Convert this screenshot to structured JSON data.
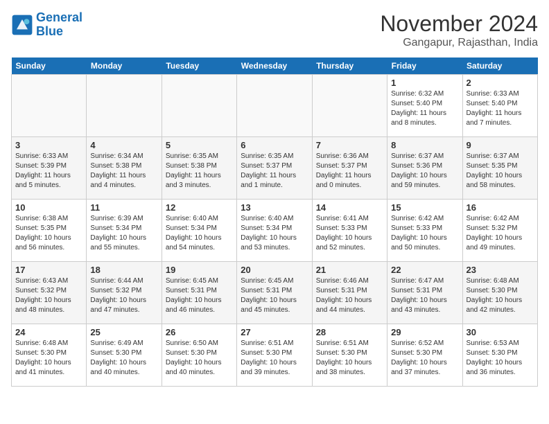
{
  "header": {
    "logo_line1": "General",
    "logo_line2": "Blue",
    "month": "November 2024",
    "location": "Gangapur, Rajasthan, India"
  },
  "weekdays": [
    "Sunday",
    "Monday",
    "Tuesday",
    "Wednesday",
    "Thursday",
    "Friday",
    "Saturday"
  ],
  "weeks": [
    [
      {
        "day": "",
        "info": ""
      },
      {
        "day": "",
        "info": ""
      },
      {
        "day": "",
        "info": ""
      },
      {
        "day": "",
        "info": ""
      },
      {
        "day": "",
        "info": ""
      },
      {
        "day": "1",
        "info": "Sunrise: 6:32 AM\nSunset: 5:40 PM\nDaylight: 11 hours and 8 minutes."
      },
      {
        "day": "2",
        "info": "Sunrise: 6:33 AM\nSunset: 5:40 PM\nDaylight: 11 hours and 7 minutes."
      }
    ],
    [
      {
        "day": "3",
        "info": "Sunrise: 6:33 AM\nSunset: 5:39 PM\nDaylight: 11 hours and 5 minutes."
      },
      {
        "day": "4",
        "info": "Sunrise: 6:34 AM\nSunset: 5:38 PM\nDaylight: 11 hours and 4 minutes."
      },
      {
        "day": "5",
        "info": "Sunrise: 6:35 AM\nSunset: 5:38 PM\nDaylight: 11 hours and 3 minutes."
      },
      {
        "day": "6",
        "info": "Sunrise: 6:35 AM\nSunset: 5:37 PM\nDaylight: 11 hours and 1 minute."
      },
      {
        "day": "7",
        "info": "Sunrise: 6:36 AM\nSunset: 5:37 PM\nDaylight: 11 hours and 0 minutes."
      },
      {
        "day": "8",
        "info": "Sunrise: 6:37 AM\nSunset: 5:36 PM\nDaylight: 10 hours and 59 minutes."
      },
      {
        "day": "9",
        "info": "Sunrise: 6:37 AM\nSunset: 5:35 PM\nDaylight: 10 hours and 58 minutes."
      }
    ],
    [
      {
        "day": "10",
        "info": "Sunrise: 6:38 AM\nSunset: 5:35 PM\nDaylight: 10 hours and 56 minutes."
      },
      {
        "day": "11",
        "info": "Sunrise: 6:39 AM\nSunset: 5:34 PM\nDaylight: 10 hours and 55 minutes."
      },
      {
        "day": "12",
        "info": "Sunrise: 6:40 AM\nSunset: 5:34 PM\nDaylight: 10 hours and 54 minutes."
      },
      {
        "day": "13",
        "info": "Sunrise: 6:40 AM\nSunset: 5:34 PM\nDaylight: 10 hours and 53 minutes."
      },
      {
        "day": "14",
        "info": "Sunrise: 6:41 AM\nSunset: 5:33 PM\nDaylight: 10 hours and 52 minutes."
      },
      {
        "day": "15",
        "info": "Sunrise: 6:42 AM\nSunset: 5:33 PM\nDaylight: 10 hours and 50 minutes."
      },
      {
        "day": "16",
        "info": "Sunrise: 6:42 AM\nSunset: 5:32 PM\nDaylight: 10 hours and 49 minutes."
      }
    ],
    [
      {
        "day": "17",
        "info": "Sunrise: 6:43 AM\nSunset: 5:32 PM\nDaylight: 10 hours and 48 minutes."
      },
      {
        "day": "18",
        "info": "Sunrise: 6:44 AM\nSunset: 5:32 PM\nDaylight: 10 hours and 47 minutes."
      },
      {
        "day": "19",
        "info": "Sunrise: 6:45 AM\nSunset: 5:31 PM\nDaylight: 10 hours and 46 minutes."
      },
      {
        "day": "20",
        "info": "Sunrise: 6:45 AM\nSunset: 5:31 PM\nDaylight: 10 hours and 45 minutes."
      },
      {
        "day": "21",
        "info": "Sunrise: 6:46 AM\nSunset: 5:31 PM\nDaylight: 10 hours and 44 minutes."
      },
      {
        "day": "22",
        "info": "Sunrise: 6:47 AM\nSunset: 5:31 PM\nDaylight: 10 hours and 43 minutes."
      },
      {
        "day": "23",
        "info": "Sunrise: 6:48 AM\nSunset: 5:30 PM\nDaylight: 10 hours and 42 minutes."
      }
    ],
    [
      {
        "day": "24",
        "info": "Sunrise: 6:48 AM\nSunset: 5:30 PM\nDaylight: 10 hours and 41 minutes."
      },
      {
        "day": "25",
        "info": "Sunrise: 6:49 AM\nSunset: 5:30 PM\nDaylight: 10 hours and 40 minutes."
      },
      {
        "day": "26",
        "info": "Sunrise: 6:50 AM\nSunset: 5:30 PM\nDaylight: 10 hours and 40 minutes."
      },
      {
        "day": "27",
        "info": "Sunrise: 6:51 AM\nSunset: 5:30 PM\nDaylight: 10 hours and 39 minutes."
      },
      {
        "day": "28",
        "info": "Sunrise: 6:51 AM\nSunset: 5:30 PM\nDaylight: 10 hours and 38 minutes."
      },
      {
        "day": "29",
        "info": "Sunrise: 6:52 AM\nSunset: 5:30 PM\nDaylight: 10 hours and 37 minutes."
      },
      {
        "day": "30",
        "info": "Sunrise: 6:53 AM\nSunset: 5:30 PM\nDaylight: 10 hours and 36 minutes."
      }
    ]
  ]
}
